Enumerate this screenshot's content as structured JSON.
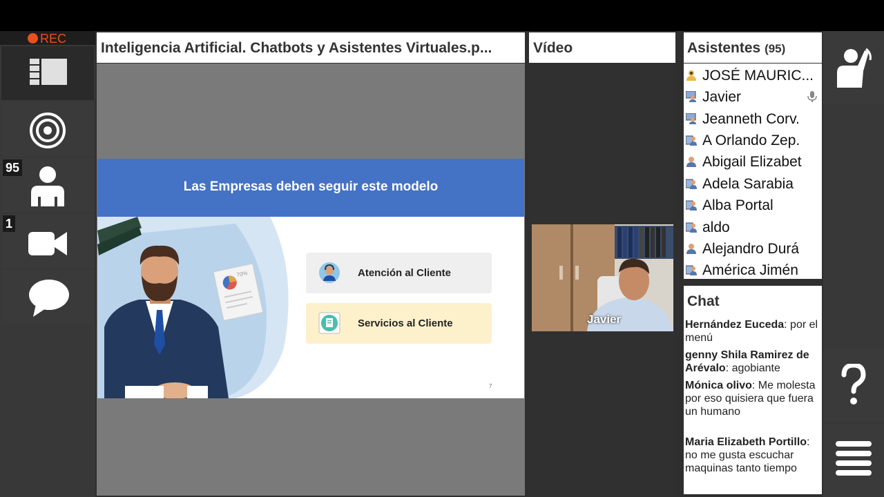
{
  "recording": {
    "label": "REC"
  },
  "sidebar": {
    "attendees_badge": "95",
    "video_badge": "1"
  },
  "presentation": {
    "title": "Inteligencia Artificial. Chatbots y Asistentes Virtuales.p...",
    "slide": {
      "heading": "Las Empresas deben seguir este modelo",
      "card1_label": "Atención al Cliente",
      "card2_label": "Servicios al Cliente",
      "page_number": "7",
      "chart_label": "70%"
    }
  },
  "video": {
    "title": "Vídeo",
    "participant_name": "Javier"
  },
  "attendees": {
    "title": "Asistentes",
    "count": "(95)",
    "items": [
      {
        "name": "JOSÉ MAURIC...",
        "role": "host"
      },
      {
        "name": "Javier",
        "role": "presenter"
      },
      {
        "name": "Jeanneth Corv.",
        "role": "presenter"
      },
      {
        "name": "A Orlando Zep.",
        "role": "attendee"
      },
      {
        "name": "Abigail Elizabet",
        "role": "attendee"
      },
      {
        "name": "Adela Sarabia",
        "role": "attendee"
      },
      {
        "name": "Alba Portal",
        "role": "attendee"
      },
      {
        "name": "aldo",
        "role": "attendee"
      },
      {
        "name": "Alejandro Durá",
        "role": "attendee"
      },
      {
        "name": "América Jimén",
        "role": "attendee"
      }
    ]
  },
  "chat": {
    "title": "Chat",
    "messages": [
      {
        "author": "Hernández Euceda",
        "text": ": por el menú"
      },
      {
        "author": "genny Shila Ramirez de Arévalo",
        "text": ": agobiante"
      },
      {
        "author": "Mónica olivo",
        "text": ": Me molesta por eso quisiera que fuera un humano"
      },
      {
        "author": "Maria Elizabeth Portillo",
        "text": ": no me gusta escuchar maquinas tanto tiempo"
      }
    ]
  },
  "colors": {
    "rec": "#e8501e",
    "slide_header": "#4472c4",
    "card_gray": "#efefef",
    "card_yellow": "#fdf1cc"
  }
}
